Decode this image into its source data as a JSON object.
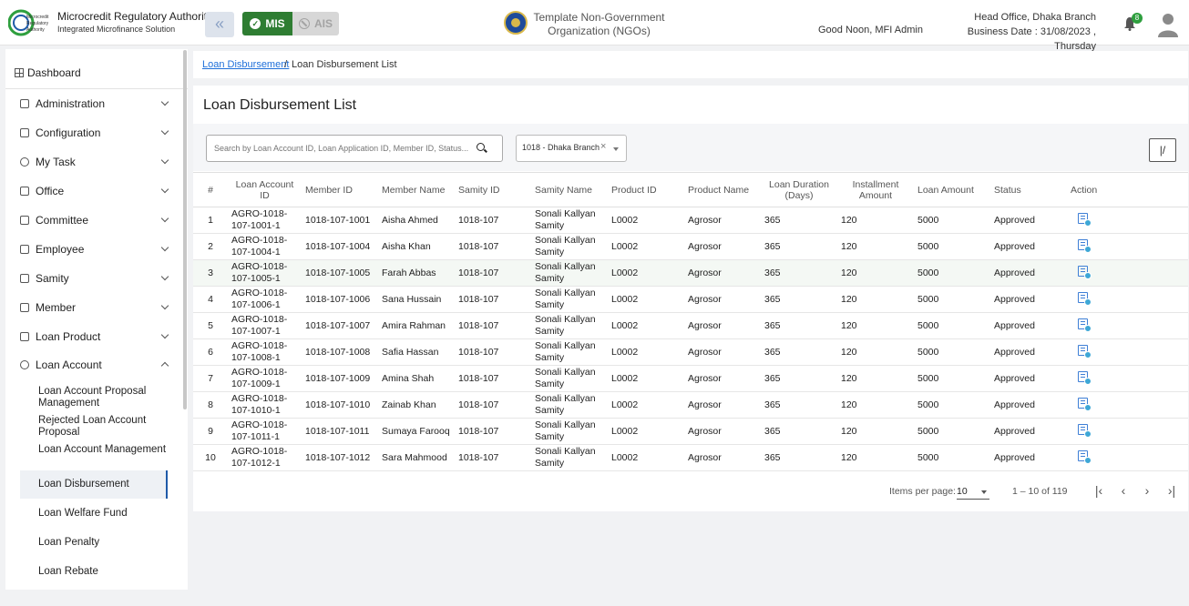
{
  "header": {
    "org_title": "Microcredit Regulatory Authority",
    "org_subtitle": "Integrated Microfinance Solution",
    "logo_text": "Microcredit Regulatory Authority",
    "mis_label": "MIS",
    "ais_label": "AIS",
    "template_name_line1": "Template Non-Government",
    "template_name_line2": "Organization (NGOs)",
    "greeting": "Good Noon, MFI Admin",
    "branch": "Head Office, Dhaka Branch",
    "business_date": "Business Date : 31/08/2023 , Thursday",
    "notification_count": "8"
  },
  "sidebar": {
    "dashboard": "Dashboard",
    "items": [
      {
        "label": "Administration"
      },
      {
        "label": "Configuration"
      },
      {
        "label": "My Task"
      },
      {
        "label": "Office"
      },
      {
        "label": "Committee"
      },
      {
        "label": "Employee"
      },
      {
        "label": "Samity"
      },
      {
        "label": "Member"
      },
      {
        "label": "Loan Product"
      },
      {
        "label": "Loan Account"
      }
    ],
    "sub_items": [
      {
        "label": "Loan Account Proposal Management"
      },
      {
        "label": "Rejected Loan Account Proposal"
      },
      {
        "label": "Loan Account Management"
      },
      {
        "label": "Loan Disbursement"
      },
      {
        "label": "Loan Welfare Fund"
      },
      {
        "label": "Loan Penalty"
      },
      {
        "label": "Loan Rebate"
      }
    ]
  },
  "breadcrumb": {
    "link": "Loan Disbursement",
    "separator": "/",
    "current": "Loan Disbursement List"
  },
  "page": {
    "title": "Loan Disbursement List",
    "search_placeholder": "Search by Loan Account ID, Loan Application ID, Member ID, Status...",
    "branch_filter": "1018 - Dhaka Branch",
    "branch_clear": "×"
  },
  "table": {
    "headers": [
      "#",
      "Loan Account ID",
      "Member ID",
      "Member Name",
      "Samity ID",
      "Samity Name",
      "Product ID",
      "Product Name",
      "Loan Duration (Days)",
      "Installment Amount",
      "Loan Amount",
      "Status",
      "Action"
    ],
    "rows": [
      [
        "1",
        "AGRO-1018-107-1001-1",
        "1018-107-1001",
        "Aisha Ahmed",
        "1018-107",
        "Sonali Kallyan Samity",
        "L0002",
        "Agrosor",
        "365",
        "120",
        "5000",
        "Approved"
      ],
      [
        "2",
        "AGRO-1018-107-1004-1",
        "1018-107-1004",
        "Aisha Khan",
        "1018-107",
        "Sonali Kallyan Samity",
        "L0002",
        "Agrosor",
        "365",
        "120",
        "5000",
        "Approved"
      ],
      [
        "3",
        "AGRO-1018-107-1005-1",
        "1018-107-1005",
        "Farah Abbas",
        "1018-107",
        "Sonali Kallyan Samity",
        "L0002",
        "Agrosor",
        "365",
        "120",
        "5000",
        "Approved"
      ],
      [
        "4",
        "AGRO-1018-107-1006-1",
        "1018-107-1006",
        "Sana Hussain",
        "1018-107",
        "Sonali Kallyan Samity",
        "L0002",
        "Agrosor",
        "365",
        "120",
        "5000",
        "Approved"
      ],
      [
        "5",
        "AGRO-1018-107-1007-1",
        "1018-107-1007",
        "Amira Rahman",
        "1018-107",
        "Sonali Kallyan Samity",
        "L0002",
        "Agrosor",
        "365",
        "120",
        "5000",
        "Approved"
      ],
      [
        "6",
        "AGRO-1018-107-1008-1",
        "1018-107-1008",
        "Safia Hassan",
        "1018-107",
        "Sonali Kallyan Samity",
        "L0002",
        "Agrosor",
        "365",
        "120",
        "5000",
        "Approved"
      ],
      [
        "7",
        "AGRO-1018-107-1009-1",
        "1018-107-1009",
        "Amina Shah",
        "1018-107",
        "Sonali Kallyan Samity",
        "L0002",
        "Agrosor",
        "365",
        "120",
        "5000",
        "Approved"
      ],
      [
        "8",
        "AGRO-1018-107-1010-1",
        "1018-107-1010",
        "Zainab Khan",
        "1018-107",
        "Sonali Kallyan Samity",
        "L0002",
        "Agrosor",
        "365",
        "120",
        "5000",
        "Approved"
      ],
      [
        "9",
        "AGRO-1018-107-1011-1",
        "1018-107-1011",
        "Sumaya Farooq",
        "1018-107",
        "Sonali Kallyan Samity",
        "L0002",
        "Agrosor",
        "365",
        "120",
        "5000",
        "Approved"
      ],
      [
        "10",
        "AGRO-1018-107-1012-1",
        "1018-107-1012",
        "Sara Mahmood",
        "1018-107",
        "Sonali Kallyan Samity",
        "L0002",
        "Agrosor",
        "365",
        "120",
        "5000",
        "Approved"
      ]
    ],
    "action_icon": "view-details-icon"
  },
  "pagination": {
    "items_per_page_label": "Items per page:",
    "items_per_page": "10",
    "range": "1 – 10 of 119"
  },
  "colors": {
    "brand_green": "#2e7d32",
    "link_blue": "#1e6fd9",
    "active_border": "#1e5aa8"
  }
}
